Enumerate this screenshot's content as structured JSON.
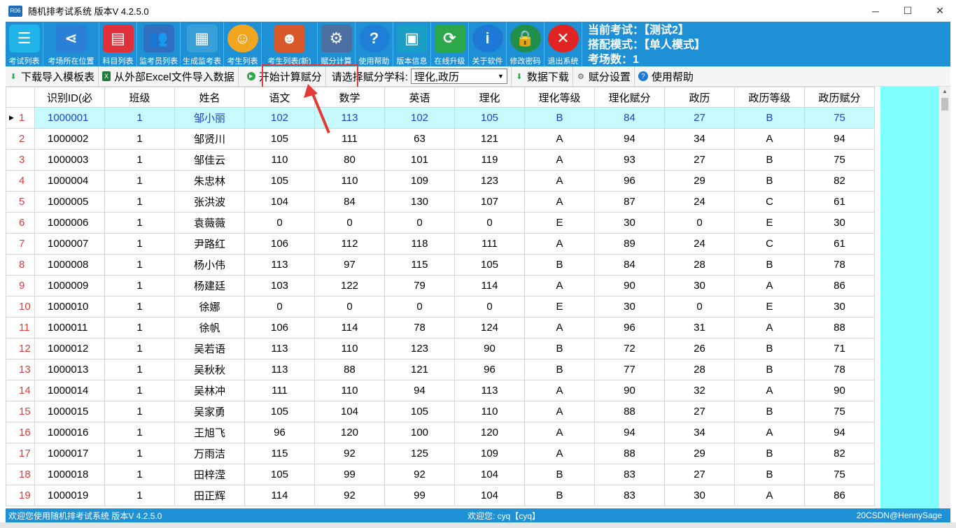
{
  "window": {
    "title": "随机排考试系统  版本V 4.2.5.0",
    "app_icon_text": "R06"
  },
  "ribbon": {
    "buttons": [
      {
        "label": "考试列表",
        "icon": "list-icon",
        "color": "#20b4e8"
      },
      {
        "label": "考场所在位置",
        "icon": "share-icon",
        "color": "#2a7fd6"
      },
      {
        "label": "科目列表",
        "icon": "book-icon",
        "color": "#e0303a"
      },
      {
        "label": "监考员列表",
        "icon": "people-icon",
        "color": "#2e6fbf"
      },
      {
        "label": "生成监考表",
        "icon": "table-icon",
        "color": "#38a0d8"
      },
      {
        "label": "考生列表",
        "icon": "student-icon",
        "color": "#f2a51e"
      },
      {
        "label": "考生列表(新)",
        "icon": "student-new-icon",
        "color": "#d8582a"
      },
      {
        "label": "赋分计算",
        "icon": "calc-icon",
        "color": "#4a6fa0"
      },
      {
        "label": "使用帮助",
        "icon": "help-icon",
        "color": "#1f7fd6"
      },
      {
        "label": "版本信息",
        "icon": "monitor-icon",
        "color": "#1aa0c8"
      },
      {
        "label": "在线升级",
        "icon": "refresh-icon",
        "color": "#2aa84a"
      },
      {
        "label": "关于软件",
        "icon": "info-icon",
        "color": "#1e78d6"
      },
      {
        "label": "修改密码",
        "icon": "lock-icon",
        "color": "#1f8f4a"
      },
      {
        "label": "退出系统",
        "icon": "close-icon",
        "color": "#e02424"
      }
    ],
    "info": {
      "current_exam": "当前考试：【测试2】",
      "mode": "搭配模式：【单人模式】",
      "rooms": "考场数：1"
    }
  },
  "toolbar": {
    "download_template": "下载导入模板表",
    "import_excel": "从外部Excel文件导入数据",
    "start_calc": "开始计算赋分",
    "subject_label": "请选择赋分学科:",
    "subject_value": "理化,政历",
    "data_download": "数据下载",
    "score_settings": "赋分设置",
    "help": "使用帮助"
  },
  "table": {
    "columns": [
      "识别ID(必",
      "班级",
      "姓名",
      "语文",
      "数学",
      "英语",
      "理化",
      "理化等级",
      "理化赋分",
      "政历",
      "政历等级",
      "政历赋分"
    ],
    "rows": [
      [
        "1000001",
        "1",
        "邹小丽",
        "102",
        "113",
        "102",
        "105",
        "B",
        "84",
        "27",
        "B",
        "75"
      ],
      [
        "1000002",
        "1",
        "邹贤川",
        "105",
        "111",
        "63",
        "121",
        "A",
        "94",
        "34",
        "A",
        "94"
      ],
      [
        "1000003",
        "1",
        "邹佳云",
        "110",
        "80",
        "101",
        "119",
        "A",
        "93",
        "27",
        "B",
        "75"
      ],
      [
        "1000004",
        "1",
        "朱忠林",
        "105",
        "110",
        "109",
        "123",
        "A",
        "96",
        "29",
        "B",
        "82"
      ],
      [
        "1000005",
        "1",
        "张洪波",
        "104",
        "84",
        "130",
        "107",
        "A",
        "87",
        "24",
        "C",
        "61"
      ],
      [
        "1000006",
        "1",
        "袁薇薇",
        "0",
        "0",
        "0",
        "0",
        "E",
        "30",
        "0",
        "E",
        "30"
      ],
      [
        "1000007",
        "1",
        "尹路红",
        "106",
        "112",
        "118",
        "111",
        "A",
        "89",
        "24",
        "C",
        "61"
      ],
      [
        "1000008",
        "1",
        "杨小伟",
        "113",
        "97",
        "115",
        "105",
        "B",
        "84",
        "28",
        "B",
        "78"
      ],
      [
        "1000009",
        "1",
        "杨建廷",
        "103",
        "122",
        "79",
        "114",
        "A",
        "90",
        "30",
        "A",
        "86"
      ],
      [
        "1000010",
        "1",
        "徐娜",
        "0",
        "0",
        "0",
        "0",
        "E",
        "30",
        "0",
        "E",
        "30"
      ],
      [
        "1000011",
        "1",
        "徐帆",
        "106",
        "114",
        "78",
        "124",
        "A",
        "96",
        "31",
        "A",
        "88"
      ],
      [
        "1000012",
        "1",
        "吴若语",
        "113",
        "110",
        "123",
        "90",
        "B",
        "72",
        "26",
        "B",
        "71"
      ],
      [
        "1000013",
        "1",
        "吴秋秋",
        "113",
        "88",
        "121",
        "96",
        "B",
        "77",
        "28",
        "B",
        "78"
      ],
      [
        "1000014",
        "1",
        "吴林冲",
        "111",
        "110",
        "94",
        "113",
        "A",
        "90",
        "32",
        "A",
        "90"
      ],
      [
        "1000015",
        "1",
        "吴家勇",
        "105",
        "104",
        "105",
        "110",
        "A",
        "88",
        "27",
        "B",
        "75"
      ],
      [
        "1000016",
        "1",
        "王旭飞",
        "96",
        "120",
        "100",
        "120",
        "A",
        "94",
        "34",
        "A",
        "94"
      ],
      [
        "1000017",
        "1",
        "万雨洁",
        "115",
        "92",
        "125",
        "109",
        "A",
        "88",
        "29",
        "B",
        "82"
      ],
      [
        "1000018",
        "1",
        "田梓滢",
        "105",
        "99",
        "92",
        "104",
        "B",
        "83",
        "27",
        "B",
        "75"
      ],
      [
        "1000019",
        "1",
        "田正辉",
        "114",
        "92",
        "99",
        "104",
        "B",
        "83",
        "30",
        "A",
        "86"
      ]
    ]
  },
  "statusbar": {
    "left": "欢迎您使用随机排考试系统  版本V 4.2.5.0",
    "middle": "欢迎您:  cyq【cyq】",
    "right": "20CSDN@HennySage"
  },
  "colors": {
    "accent": "#1e90d6",
    "highlight": "#e53935",
    "selected_row": "#c7fbff",
    "cyan": "#80ffff"
  }
}
